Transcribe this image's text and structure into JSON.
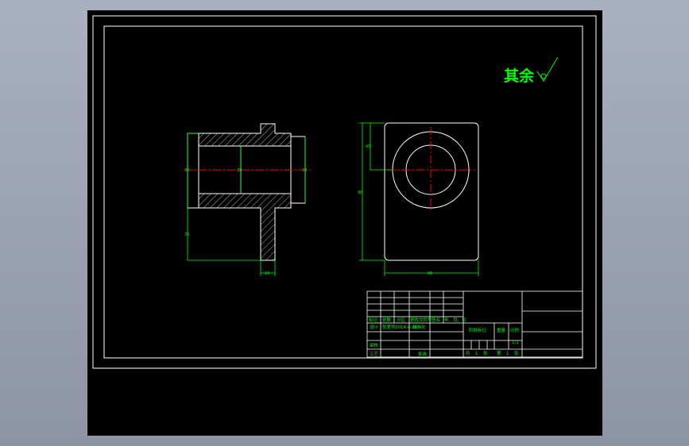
{
  "colors": {
    "background": "#9aa1b0",
    "paper": "#000000",
    "border": "#ffffff",
    "geometry": "#ffffff",
    "dimension": "#00ff00",
    "centerline": "#ff0000",
    "text": "#00ff00"
  },
  "roughness_note": {
    "text": "其余"
  },
  "dims": {
    "front_left": "32",
    "front_mid": "20",
    "front_right": "38",
    "front_bottom_height": "36",
    "front_flange": "10",
    "side_width": "80",
    "side_height": "90",
    "side_center": "45"
  },
  "title_block": {
    "change_row": [
      "标记",
      "处数",
      "分区",
      "更改文件号",
      "签名",
      "年、月、日"
    ],
    "designer_label": "设计",
    "designer_name": "张爱华",
    "design_date": "2014.6.20",
    "standardize_label": "标准化",
    "stage_label": "阶段标记",
    "weight_label": "重量",
    "scale_label": "比例",
    "scale_value": "1:1",
    "review_label": "审核",
    "process_label": "工艺",
    "approve_label": "批准",
    "sheet_total_prefix": "共",
    "sheet_total": "1",
    "sheet_unit1": "张",
    "sheet_index_prefix": "第",
    "sheet_index": "1",
    "sheet_unit2": "张"
  }
}
